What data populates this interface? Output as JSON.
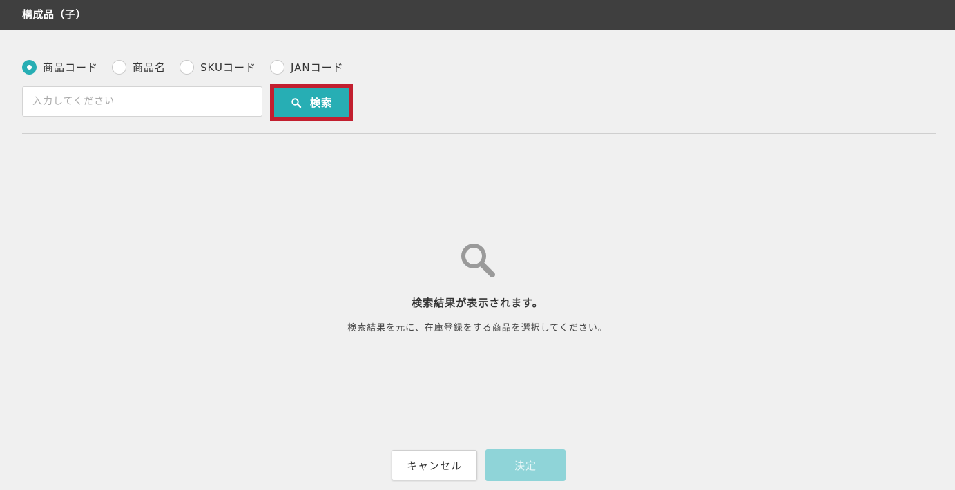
{
  "header": {
    "title": "構成品（子）"
  },
  "search_type": {
    "selected": "商品コード",
    "options": [
      {
        "label": "商品コード",
        "checked": true
      },
      {
        "label": "商品名",
        "checked": false
      },
      {
        "label": "SKUコード",
        "checked": false
      },
      {
        "label": "JANコード",
        "checked": false
      }
    ]
  },
  "search": {
    "placeholder": "入力してください",
    "value": "",
    "button_label": "検索",
    "button_icon": "search-icon",
    "highlight_color": "#c21f2f"
  },
  "empty_state": {
    "icon": "search-icon",
    "title": "検索結果が表示されます。",
    "description": "検索結果を元に、在庫登録をする商品を選択してください。"
  },
  "footer": {
    "cancel_label": "キャンセル",
    "confirm_label": "決定",
    "confirm_disabled": true
  },
  "colors": {
    "accent": "#27aeb4",
    "header_bg": "#3f3f3f",
    "disabled_accent": "#8fd4d8"
  }
}
